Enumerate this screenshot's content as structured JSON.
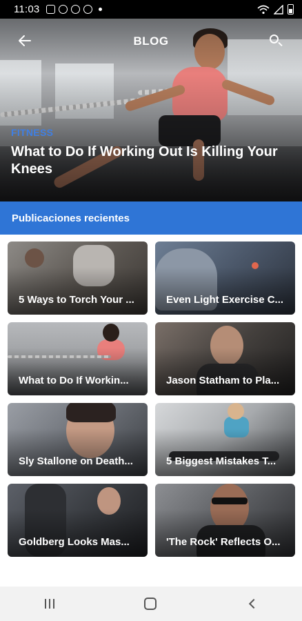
{
  "status_bar": {
    "time": "11:03"
  },
  "appbar": {
    "title": "BLOG"
  },
  "hero": {
    "category": "FITNESS",
    "title": "What to Do If Working Out Is Killing Your Knees"
  },
  "section": {
    "title": "Publicaciones recientes"
  },
  "posts": [
    {
      "title": "5 Ways to Torch Your ..."
    },
    {
      "title": "Even Light Exercise C..."
    },
    {
      "title": "What to Do If Workin..."
    },
    {
      "title": "Jason Statham to Pla..."
    },
    {
      "title": "Sly Stallone on Death..."
    },
    {
      "title": "5 Biggest Mistakes T..."
    },
    {
      "title": "Goldberg Looks Mas..."
    },
    {
      "title": "'The Rock' Reflects O..."
    }
  ],
  "colors": {
    "accent": "#2f75d6",
    "category": "#3f7fe4",
    "nav_bg": "#f2f2f2"
  }
}
